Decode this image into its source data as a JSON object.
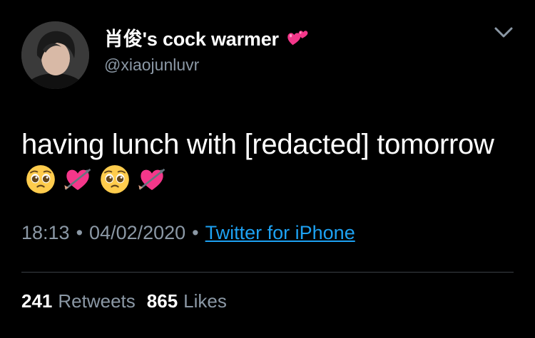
{
  "tweet": {
    "display_name": "肖俊's cock warmer",
    "name_emoji": "two-hearts-icon",
    "handle": "@xiaojunluvr",
    "text": "having lunch with [redacted] tomorrow",
    "text_emojis": [
      "pleading-face-icon",
      "heart-with-arrow-icon",
      "pleading-face-icon",
      "heart-with-arrow-icon"
    ],
    "time": "18:13",
    "separator": "•",
    "date": "04/02/2020",
    "source": "Twitter for iPhone"
  },
  "stats": {
    "retweets_count": "241",
    "retweets_label": "Retweets",
    "likes_count": "865",
    "likes_label": "Likes"
  },
  "colors": {
    "background": "#000000",
    "text": "#ffffff",
    "secondary": "#8b98a5",
    "link": "#1da1f2",
    "divider": "#3a3f45"
  }
}
